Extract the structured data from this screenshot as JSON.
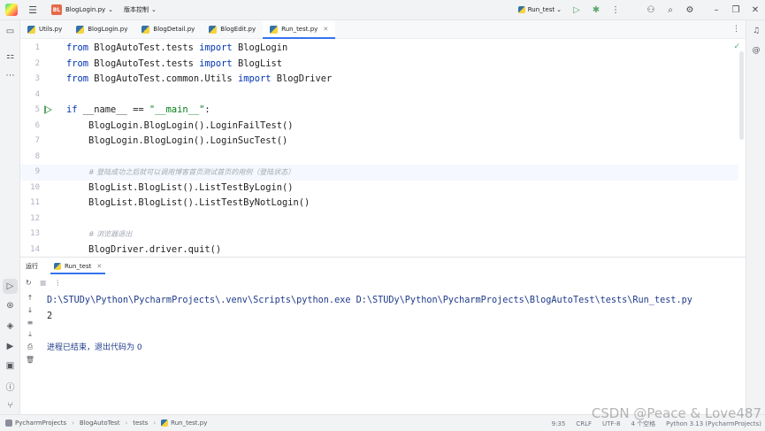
{
  "titlebar": {
    "project_badge": "BL",
    "project_name": "BlogLogin.py",
    "vcs_label": "版本控制",
    "run_config": "Run_test"
  },
  "tabs": [
    {
      "label": "Utils.py",
      "active": false
    },
    {
      "label": "BlogLogin.py",
      "active": false
    },
    {
      "label": "BlogDetail.py",
      "active": false
    },
    {
      "label": "BlogEdit.py",
      "active": false
    },
    {
      "label": "Run_test.py",
      "active": true
    }
  ],
  "editor": {
    "lines": [
      {
        "n": "1",
        "parts": [
          {
            "t": "from",
            "c": "kw"
          },
          {
            "t": " BlogAutoTest.tests ",
            "c": "idt"
          },
          {
            "t": "import",
            "c": "kw"
          },
          {
            "t": " BlogLogin",
            "c": "idt"
          }
        ]
      },
      {
        "n": "2",
        "parts": [
          {
            "t": "from",
            "c": "kw"
          },
          {
            "t": " BlogAutoTest.tests ",
            "c": "idt"
          },
          {
            "t": "import",
            "c": "kw"
          },
          {
            "t": " BlogList",
            "c": "idt"
          }
        ]
      },
      {
        "n": "3",
        "parts": [
          {
            "t": "from",
            "c": "kw"
          },
          {
            "t": " BlogAutoTest.common.Utils ",
            "c": "idt"
          },
          {
            "t": "import",
            "c": "kw"
          },
          {
            "t": " BlogDriver",
            "c": "idt"
          }
        ]
      },
      {
        "n": "4",
        "parts": []
      },
      {
        "n": "5",
        "run": true,
        "parts": [
          {
            "t": "if",
            "c": "kw"
          },
          {
            "t": " __name__ == ",
            "c": "idt"
          },
          {
            "t": "\"__main__\"",
            "c": "str"
          },
          {
            "t": ":",
            "c": "idt"
          }
        ]
      },
      {
        "n": "6",
        "parts": [
          {
            "t": "    BlogLogin.BlogLogin().LoginFailTest()",
            "c": "idt"
          }
        ]
      },
      {
        "n": "7",
        "parts": [
          {
            "t": "    BlogLogin.BlogLogin().LoginSucTest()",
            "c": "idt"
          }
        ]
      },
      {
        "n": "8",
        "parts": []
      },
      {
        "n": "9",
        "current": true,
        "parts": [
          {
            "t": "    ",
            "c": "idt"
          },
          {
            "t": "# 登陆成功之后就可以调用博客首页测试首页的用例（登陆状态）",
            "c": "cm"
          }
        ]
      },
      {
        "n": "10",
        "parts": [
          {
            "t": "    BlogList.BlogList().ListTestByLogin()",
            "c": "idt"
          }
        ]
      },
      {
        "n": "11",
        "parts": [
          {
            "t": "    BlogList.BlogList().ListTestByNotLogin()",
            "c": "idt"
          }
        ]
      },
      {
        "n": "12",
        "parts": []
      },
      {
        "n": "13",
        "parts": [
          {
            "t": "    ",
            "c": "idt"
          },
          {
            "t": "# 浏览器退出",
            "c": "cm"
          }
        ]
      },
      {
        "n": "14",
        "parts": [
          {
            "t": "    BlogDriver.driver.quit()",
            "c": "idt"
          }
        ]
      }
    ]
  },
  "run_panel": {
    "title": "运行",
    "tab_label": "Run_test",
    "console": [
      {
        "text": "D:\\STUDy\\Python\\PycharmProjects\\.venv\\Scripts\\python.exe D:\\STUDy\\Python\\PycharmProjects\\BlogAutoTest\\tests\\Run_test.py",
        "cls": "cmd"
      },
      {
        "text": "2",
        "cls": ""
      },
      {
        "text": "",
        "cls": ""
      },
      {
        "text": "进程已结束，退出代码为 0",
        "cls": "exitmsg"
      }
    ]
  },
  "statusbar": {
    "breadcrumb": [
      "PycharmProjects",
      "BlogAutoTest",
      "tests",
      "Run_test.py"
    ],
    "position": "9:35",
    "line_sep": "CRLF",
    "encoding": "UTF-8",
    "indent": "4 个空格",
    "interpreter": "Python 3.13 (PycharmProjects)"
  },
  "watermark": "CSDN @Peace & Love487",
  "colors": {
    "accent": "#3574f0",
    "keyword": "#0033b3",
    "string": "#067d17",
    "run_green": "#59a869"
  }
}
